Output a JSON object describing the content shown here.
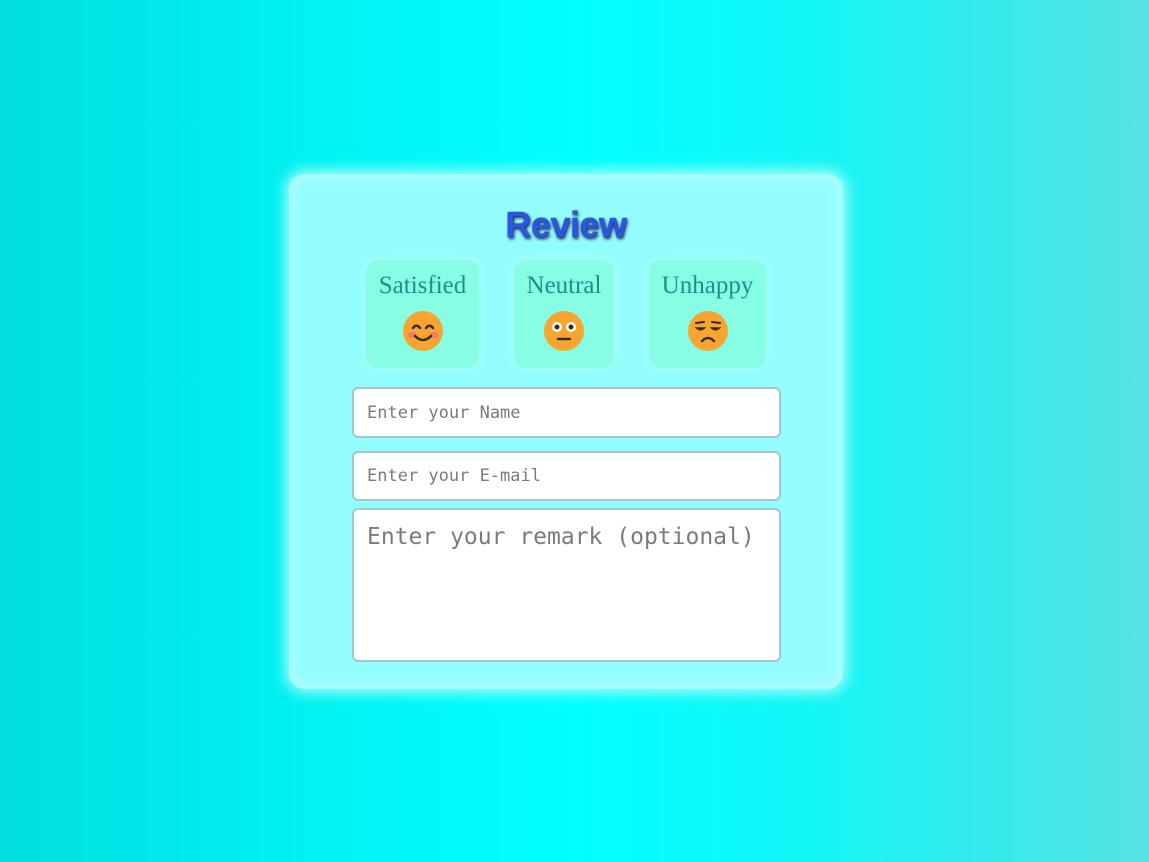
{
  "form": {
    "title": "Review",
    "moods": [
      {
        "label": "Satisfied",
        "icon": "smiling-face-icon"
      },
      {
        "label": "Neutral",
        "icon": "neutral-face-icon"
      },
      {
        "label": "Unhappy",
        "icon": "unhappy-face-icon"
      }
    ],
    "name_placeholder": "Enter your Name",
    "email_placeholder": "Enter your E-mail",
    "remark_placeholder": "Enter your remark (optional)"
  },
  "colors": {
    "title": "#2a57e0",
    "card": "#93fdfd",
    "mood_card": "#87fde4",
    "mood_label": "#1c8f8b",
    "emoji_face": "#f7a530"
  }
}
